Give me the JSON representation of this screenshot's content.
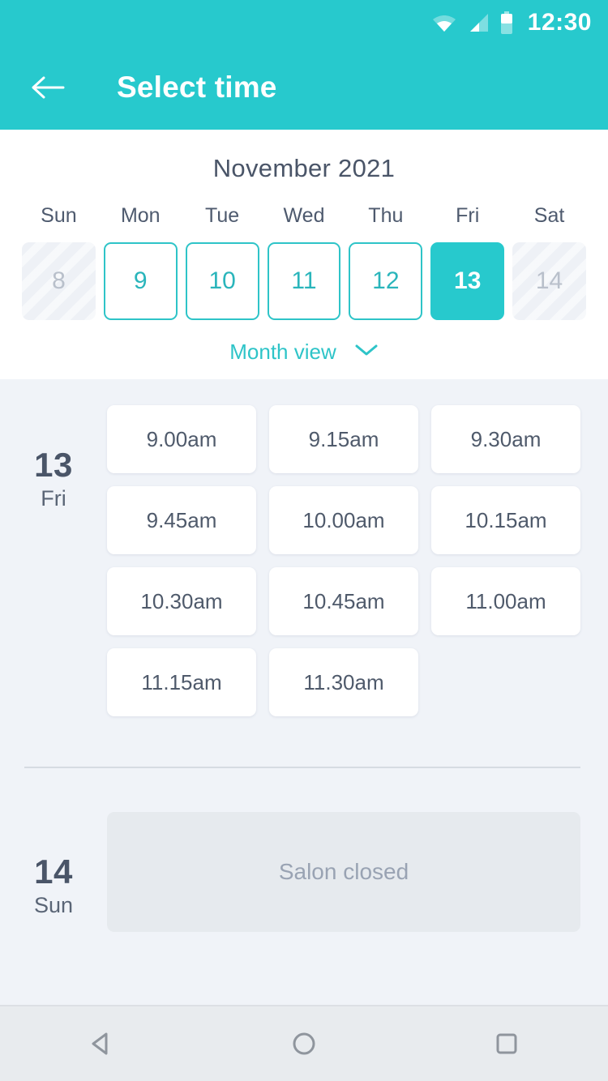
{
  "status_bar": {
    "time": "12:30",
    "icons": [
      "wifi-icon",
      "signal-icon",
      "battery-icon"
    ]
  },
  "app_bar": {
    "back_icon": "back-arrow-icon",
    "title": "Select time"
  },
  "calendar": {
    "month_title": "November 2021",
    "weekdays": [
      "Sun",
      "Mon",
      "Tue",
      "Wed",
      "Thu",
      "Fri",
      "Sat"
    ],
    "days": [
      {
        "label": "8",
        "state": "disabled"
      },
      {
        "label": "9",
        "state": "available"
      },
      {
        "label": "10",
        "state": "available"
      },
      {
        "label": "11",
        "state": "available"
      },
      {
        "label": "12",
        "state": "available"
      },
      {
        "label": "13",
        "state": "selected"
      },
      {
        "label": "14",
        "state": "disabled"
      }
    ],
    "month_view_label": "Month view",
    "month_view_icon": "chevron-down-icon"
  },
  "schedule": [
    {
      "day_number": "13",
      "day_name": "Fri",
      "slots": [
        "9.00am",
        "9.15am",
        "9.30am",
        "9.45am",
        "10.00am",
        "10.15am",
        "10.30am",
        "10.45am",
        "11.00am",
        "11.15am",
        "11.30am"
      ]
    },
    {
      "day_number": "14",
      "day_name": "Sun",
      "closed_text": "Salon closed"
    }
  ],
  "nav_bar": {
    "back_icon": "nav-back-triangle-icon",
    "home_icon": "nav-home-circle-icon",
    "recents_icon": "nav-recents-square-icon"
  },
  "colors": {
    "accent": "#27c9cd",
    "accent_border": "#2ec4c8",
    "text_dark": "#4a5568",
    "background": "#f0f3f8",
    "closed_panel": "#e6eaee"
  }
}
